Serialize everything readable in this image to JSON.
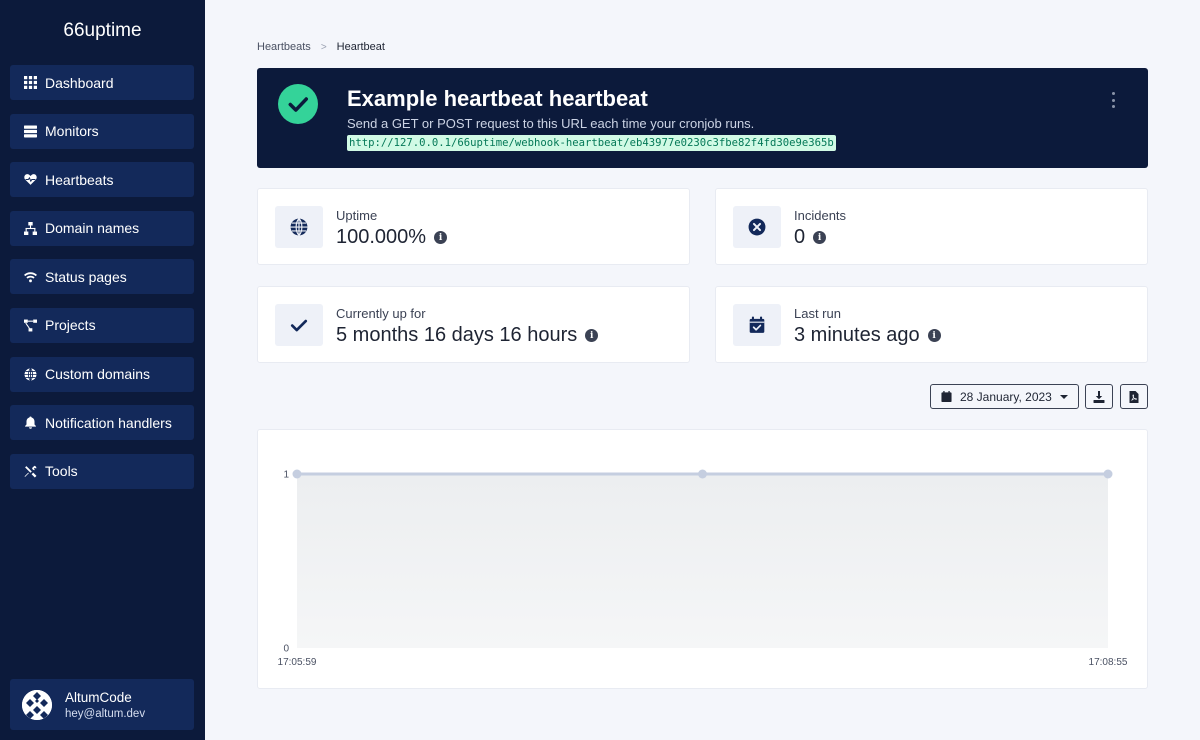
{
  "app": {
    "brand": "66uptime"
  },
  "sidebar": {
    "items": [
      {
        "label": "Dashboard",
        "icon": "grid-icon"
      },
      {
        "label": "Monitors",
        "icon": "server-icon"
      },
      {
        "label": "Heartbeats",
        "icon": "heartbeat-icon"
      },
      {
        "label": "Domain names",
        "icon": "network-icon"
      },
      {
        "label": "Status pages",
        "icon": "wifi-icon"
      },
      {
        "label": "Projects",
        "icon": "project-diagram-icon"
      },
      {
        "label": "Custom domains",
        "icon": "globe-icon"
      },
      {
        "label": "Notification handlers",
        "icon": "bell-icon"
      },
      {
        "label": "Tools",
        "icon": "tools-icon"
      }
    ],
    "user": {
      "name": "AltumCode",
      "email": "hey@altum.dev"
    }
  },
  "breadcrumb": {
    "parent": "Heartbeats",
    "separator": ">",
    "current": "Heartbeat"
  },
  "heartbeat": {
    "title": "Example heartbeat heartbeat",
    "description": "Send a GET or POST request to this URL each time your cronjob runs.",
    "url": "http://127.0.0.1/66uptime/webhook-heartbeat/eb43977e0230c3fbe82f4fd30e9e365b",
    "status_color": "#34d399"
  },
  "stats": {
    "uptime": {
      "label": "Uptime",
      "value": "100.000%"
    },
    "incidents": {
      "label": "Incidents",
      "value": "0"
    },
    "up_for": {
      "label": "Currently up for",
      "value": "5 months 16 days 16 hours"
    },
    "last_run": {
      "label": "Last run",
      "value": "3 minutes ago"
    }
  },
  "toolbar": {
    "date": "28 January, 2023"
  },
  "chart_data": {
    "type": "area",
    "x": [
      "17:05:59",
      "17:07:27",
      "17:08:55"
    ],
    "x_tick_labels": [
      "17:05:59",
      "17:08:55"
    ],
    "values": [
      1,
      1,
      1
    ],
    "y_ticks": [
      "0",
      "1"
    ],
    "ylim": [
      0,
      1
    ],
    "line_color": "#c5cee0",
    "fill_color": "#eceef0",
    "grid": false
  }
}
